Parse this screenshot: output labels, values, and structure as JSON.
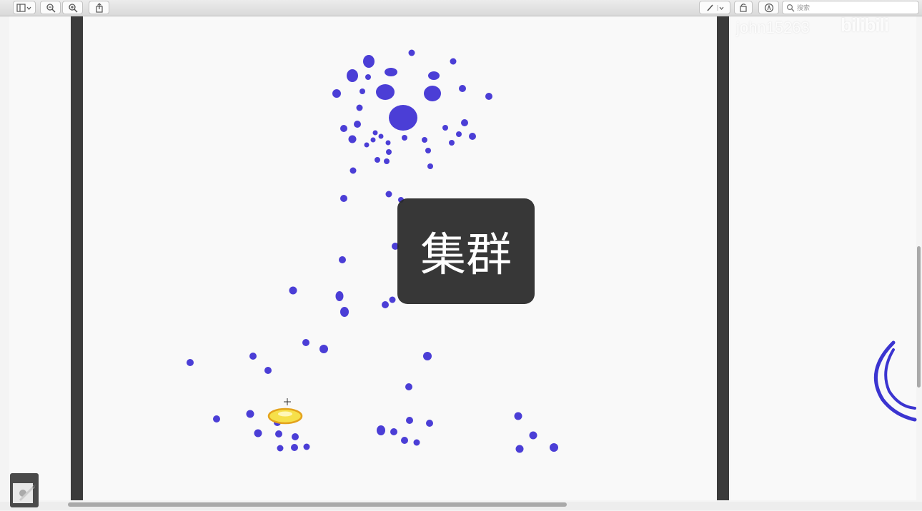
{
  "toolbar": {
    "search_placeholder": "搜索",
    "icons": [
      "sidebar-icon",
      "zoom-out-icon",
      "zoom-in-icon",
      "share-icon",
      "pen-icon",
      "rotate-icon",
      "markup-icon",
      "search-icon"
    ]
  },
  "watermark": {
    "user": "john15263",
    "logo": "bilibili"
  },
  "overlay": {
    "label": "集群"
  },
  "colors": {
    "dot": "#4b3ed6",
    "highlight": "#f6e04a",
    "rail": "#3b3b3b"
  }
}
